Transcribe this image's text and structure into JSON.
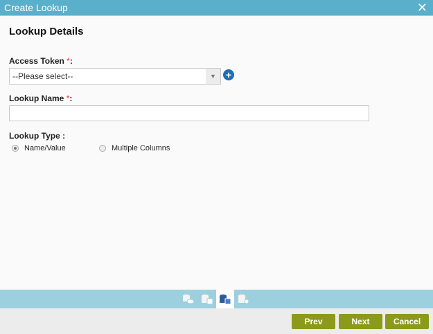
{
  "dialog": {
    "title": "Create Lookup",
    "close_label": "✕"
  },
  "section_title": "Lookup Details",
  "access_token": {
    "label": "Access Token",
    "required": "*",
    "colon": ":",
    "value": "--Please select--",
    "add_icon": "plus-circle-icon"
  },
  "lookup_name": {
    "label": "Lookup Name",
    "required": "*",
    "colon": ":",
    "value": ""
  },
  "lookup_type": {
    "label": "Lookup Type",
    "colon": ":",
    "options": [
      {
        "label": "Name/Value",
        "selected": true
      },
      {
        "label": "Multiple Columns",
        "selected": false
      }
    ]
  },
  "steps": [
    {
      "icon": "database-icon"
    },
    {
      "icon": "database-table-icon"
    },
    {
      "icon": "database-columns-icon",
      "active": true
    },
    {
      "icon": "database-settings-icon"
    }
  ],
  "buttons": {
    "prev": "Prev",
    "next": "Next",
    "cancel": "Cancel"
  },
  "colors": {
    "header": "#5aafca",
    "button": "#8c9a1b",
    "steps_bar": "#9dd0de"
  }
}
